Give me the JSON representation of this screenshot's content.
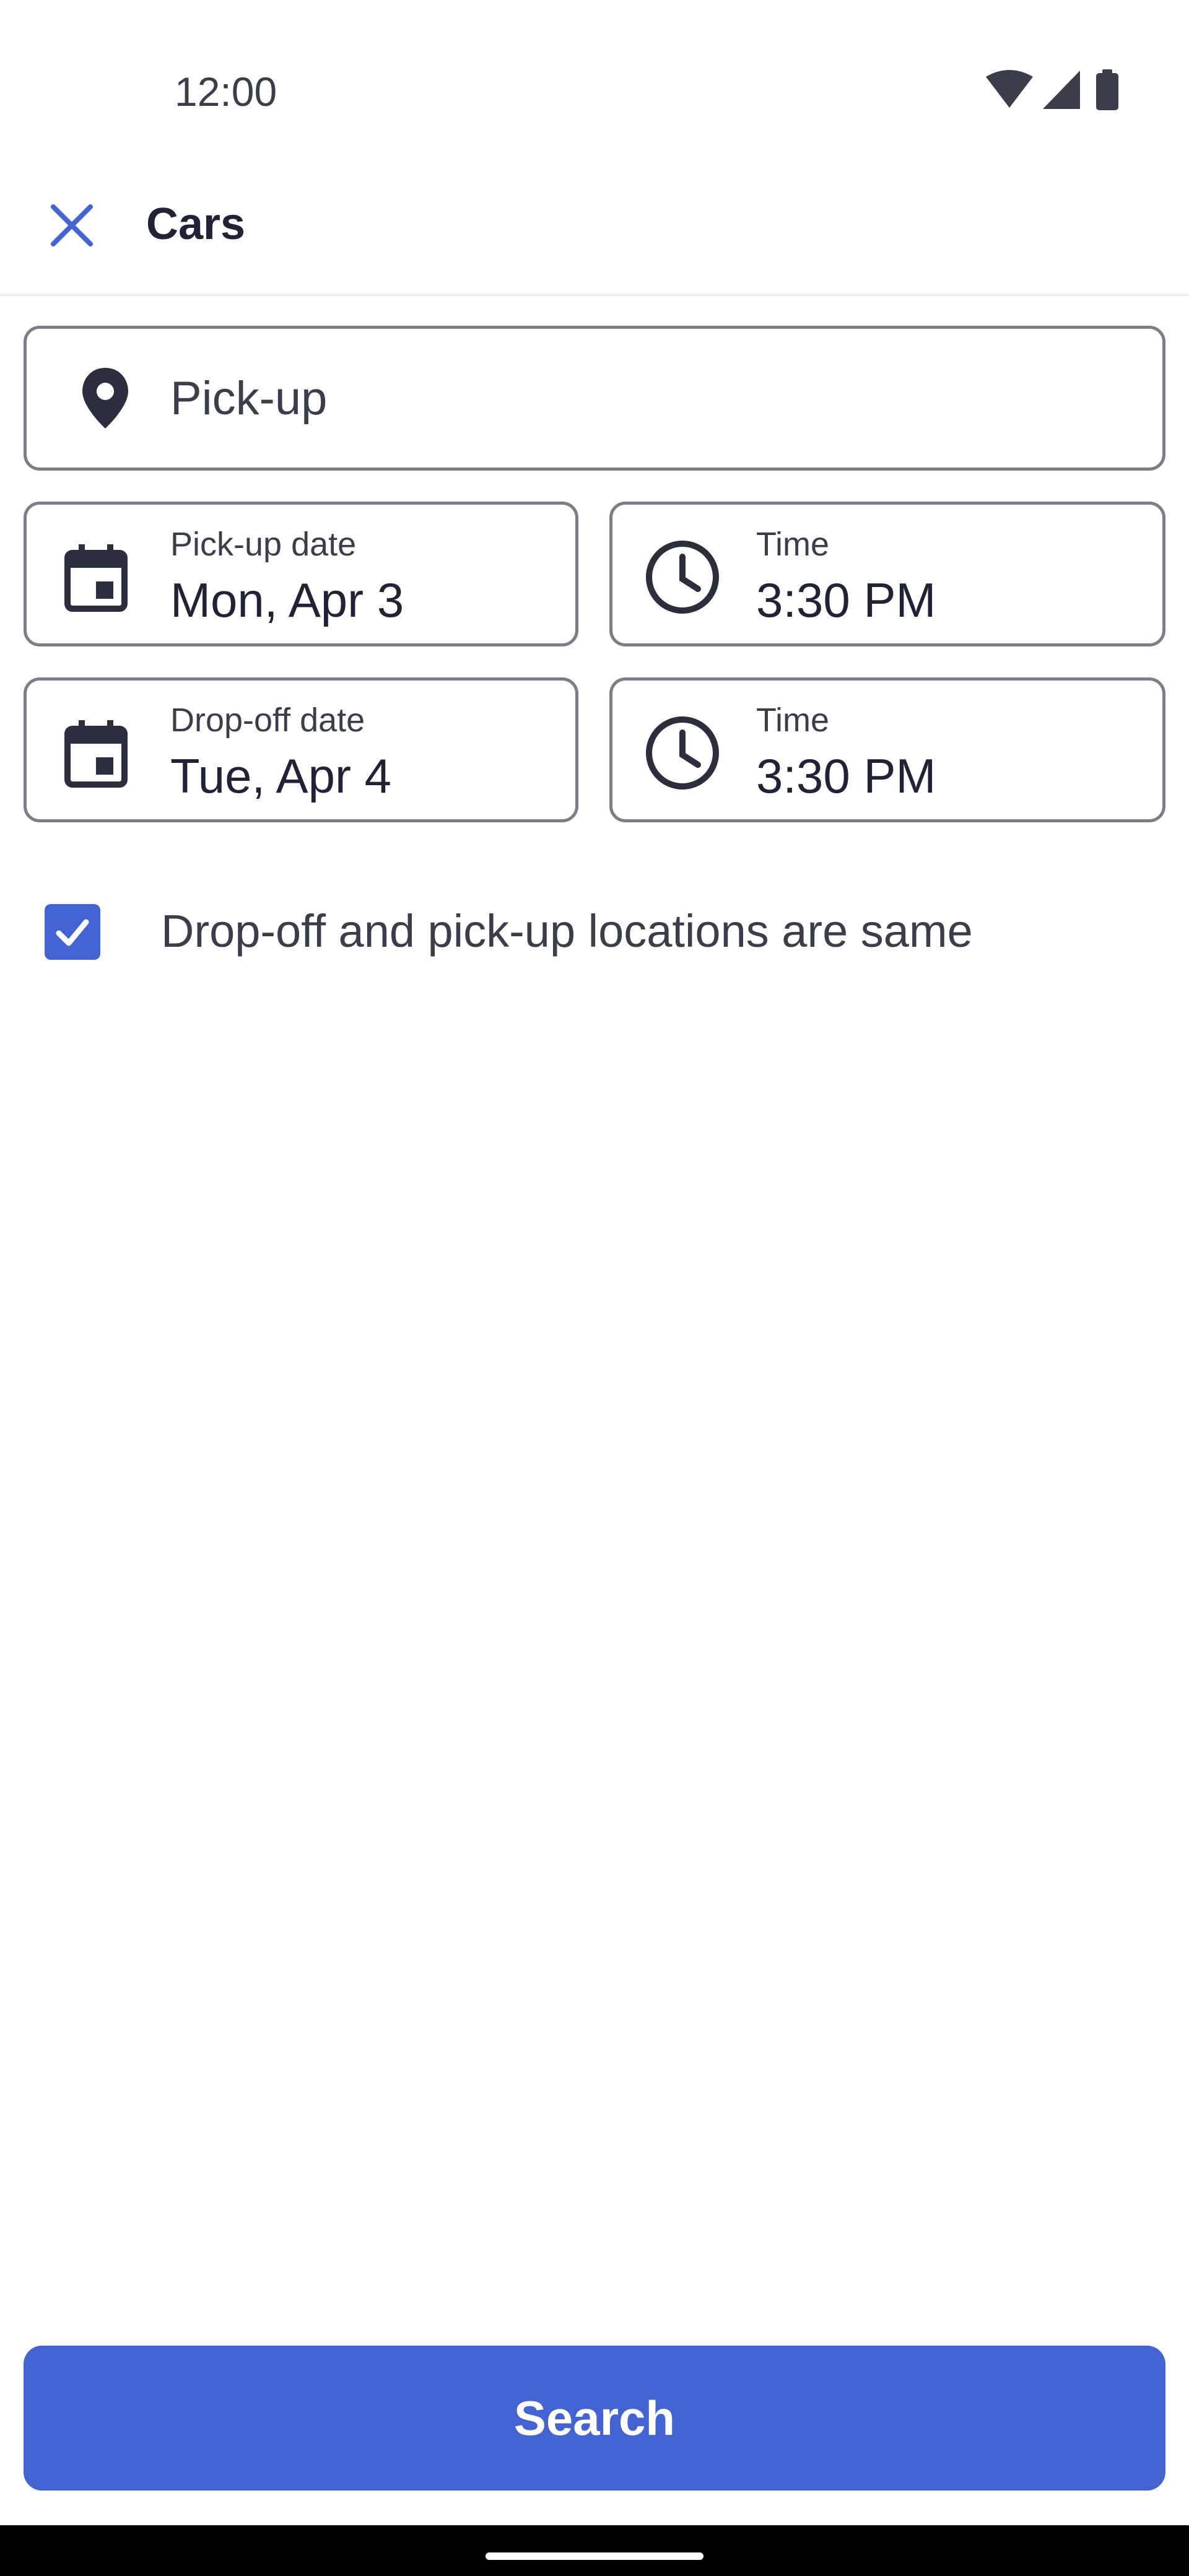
{
  "status_bar": {
    "time": "12:00",
    "icons": [
      "wifi-icon",
      "cellular-signal-icon",
      "battery-icon"
    ]
  },
  "app_bar": {
    "close_icon": "close-icon",
    "title": "Cars"
  },
  "pickup_location": {
    "placeholder": "Pick-up",
    "icon": "location-pin-icon"
  },
  "pickup_date": {
    "label": "Pick-up date",
    "value": "Mon, Apr 3",
    "icon": "calendar-icon"
  },
  "pickup_time": {
    "label": "Time",
    "value": "3:30 PM",
    "icon": "clock-icon"
  },
  "dropoff_date": {
    "label": "Drop-off date",
    "value": "Tue, Apr 4",
    "icon": "calendar-icon"
  },
  "dropoff_time": {
    "label": "Time",
    "value": "3:30 PM",
    "icon": "clock-icon"
  },
  "same_location": {
    "label": "Drop-off and pick-up locations are same",
    "checked": true
  },
  "search_button": {
    "label": "Search"
  },
  "colors": {
    "accent": "#4263d1",
    "text_primary": "#1f2335",
    "text_secondary": "#3a3d4a",
    "field_border": "#7b7d87"
  }
}
